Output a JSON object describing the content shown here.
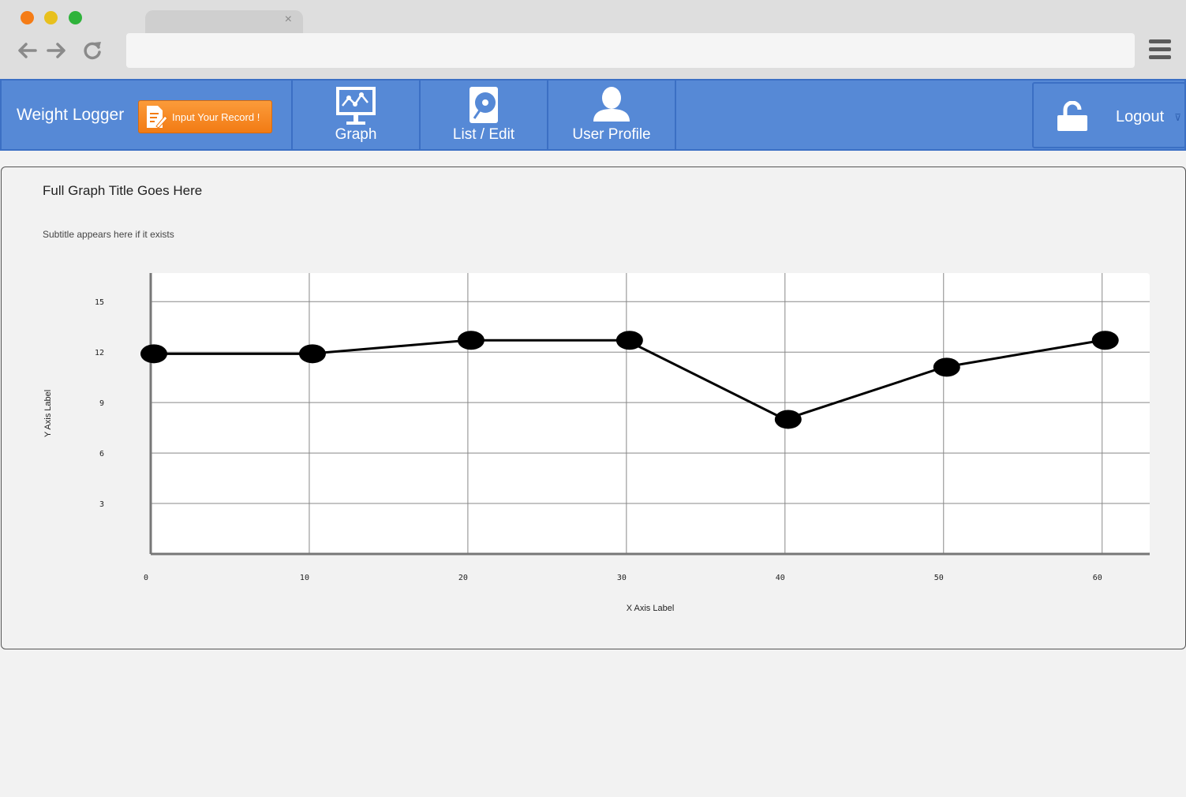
{
  "browser": {
    "tab_close": "×"
  },
  "app": {
    "brand": "Weight Logger",
    "input_button": "Input Your Record !",
    "nav": [
      {
        "label": "Graph",
        "icon": "monitor-chart-icon"
      },
      {
        "label": "List / Edit",
        "icon": "disk-icon"
      },
      {
        "label": "User Profile",
        "icon": "user-icon"
      }
    ],
    "logout": {
      "label": "Logout",
      "icon": "unlock-icon",
      "caret": "⊽"
    }
  },
  "colors": {
    "nav_bg": "#5689d6",
    "nav_border": "#3b6fc4",
    "button_orange": "#f27b14"
  },
  "graph": {
    "title": "Full Graph Title Goes Here",
    "subtitle": "Subtitle appears here if it exists"
  },
  "chart_data": {
    "type": "line",
    "title": "Full Graph Title Goes Here",
    "subtitle": "Subtitle appears here if it exists",
    "xlabel": "X Axis Label",
    "ylabel": "Y Axis Label",
    "x": [
      0,
      10,
      20,
      30,
      40,
      50,
      60
    ],
    "series": [
      {
        "values": [
          11.9,
          11.9,
          12.7,
          12.7,
          8.0,
          11.1,
          12.7
        ]
      }
    ],
    "xticks": [
      0,
      10,
      20,
      30,
      40,
      50,
      60
    ],
    "yticks": [
      3,
      6,
      9,
      12,
      15
    ],
    "xlim": [
      0,
      63
    ],
    "ylim": [
      0,
      16.7
    ],
    "grid": true
  }
}
